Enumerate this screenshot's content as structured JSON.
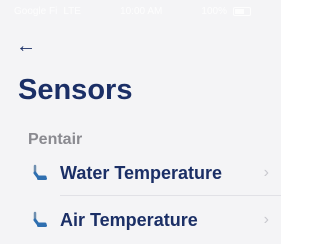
{
  "status_bar": {
    "carrier": "Google Fi",
    "network": "LTE",
    "time": "10:00 AM",
    "battery_label": "100%"
  },
  "nav": {
    "back_icon": "back-arrow-icon"
  },
  "page": {
    "title": "Sensors"
  },
  "section": {
    "header": "Pentair",
    "items": [
      {
        "label": "Water Temperature",
        "icon": "thermometer-icon"
      },
      {
        "label": "Air Temperature",
        "icon": "thermometer-icon"
      }
    ]
  },
  "colors": {
    "primary": "#1b2f66",
    "muted": "#8a8a90",
    "chevron": "#c9c9cf",
    "background": "#f4f4f6"
  }
}
